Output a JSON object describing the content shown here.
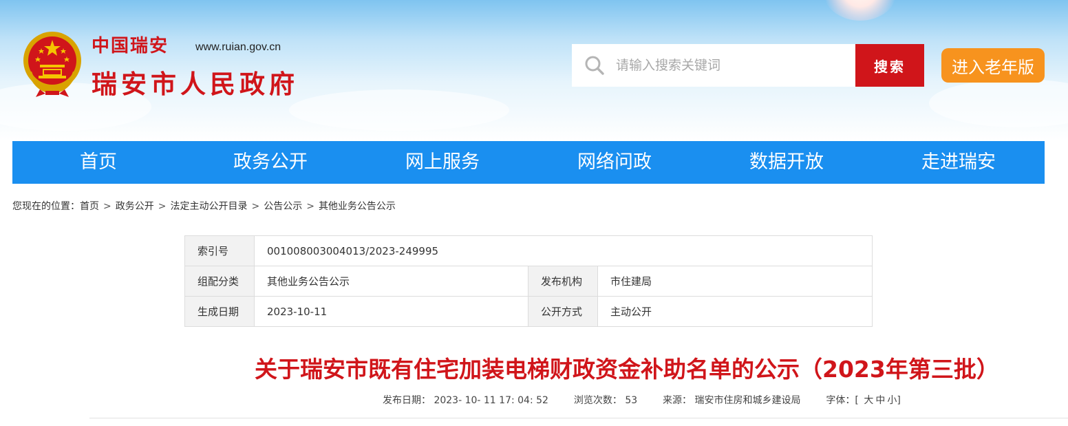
{
  "header": {
    "site_cn": "中国瑞安",
    "site_url": "www.ruian.gov.cn",
    "site_name": "瑞安市人民政府",
    "search_placeholder": "请输入搜索关键词",
    "search_button": "搜索",
    "elder_button": "进入老年版"
  },
  "nav": {
    "items": [
      {
        "label": "首页"
      },
      {
        "label": "政务公开"
      },
      {
        "label": "网上服务"
      },
      {
        "label": "网络问政"
      },
      {
        "label": "数据开放"
      },
      {
        "label": "走进瑞安"
      }
    ]
  },
  "breadcrumb": {
    "prefix": "您现在的位置：",
    "items": [
      "首页",
      "政务公开",
      "法定主动公开目录",
      "公告公示",
      "其他业务公告公示"
    ],
    "separator": ">"
  },
  "meta": {
    "index_label": "索引号",
    "index_value": "001008003004013/2023-249995",
    "category_label": "组配分类",
    "category_value": "其他业务公告公示",
    "publisher_label": "发布机构",
    "publisher_value": "市住建局",
    "date_label": "生成日期",
    "date_value": "2023-10-11",
    "method_label": "公开方式",
    "method_value": "主动公开"
  },
  "article": {
    "title": "关于瑞安市既有住宅加装电梯财政资金补助名单的公示（2023年第三批）",
    "publish_label": "发布日期：",
    "publish_value": "2023- 10- 11 17: 04: 52",
    "views_label": "浏览次数：",
    "views_value": "53",
    "source_label": "来源：",
    "source_value": "瑞安市住房和城乡建设局",
    "font_label": "字体：",
    "font_open": "[",
    "font_large": "大",
    "font_medium": "中",
    "font_small": "小",
    "font_close": "]"
  },
  "colors": {
    "brand_red": "#d0151a",
    "nav_blue": "#1a8ff0",
    "elder_orange": "#f7931e"
  },
  "icons": {
    "emblem": "national-emblem-icon",
    "search": "search-icon"
  }
}
